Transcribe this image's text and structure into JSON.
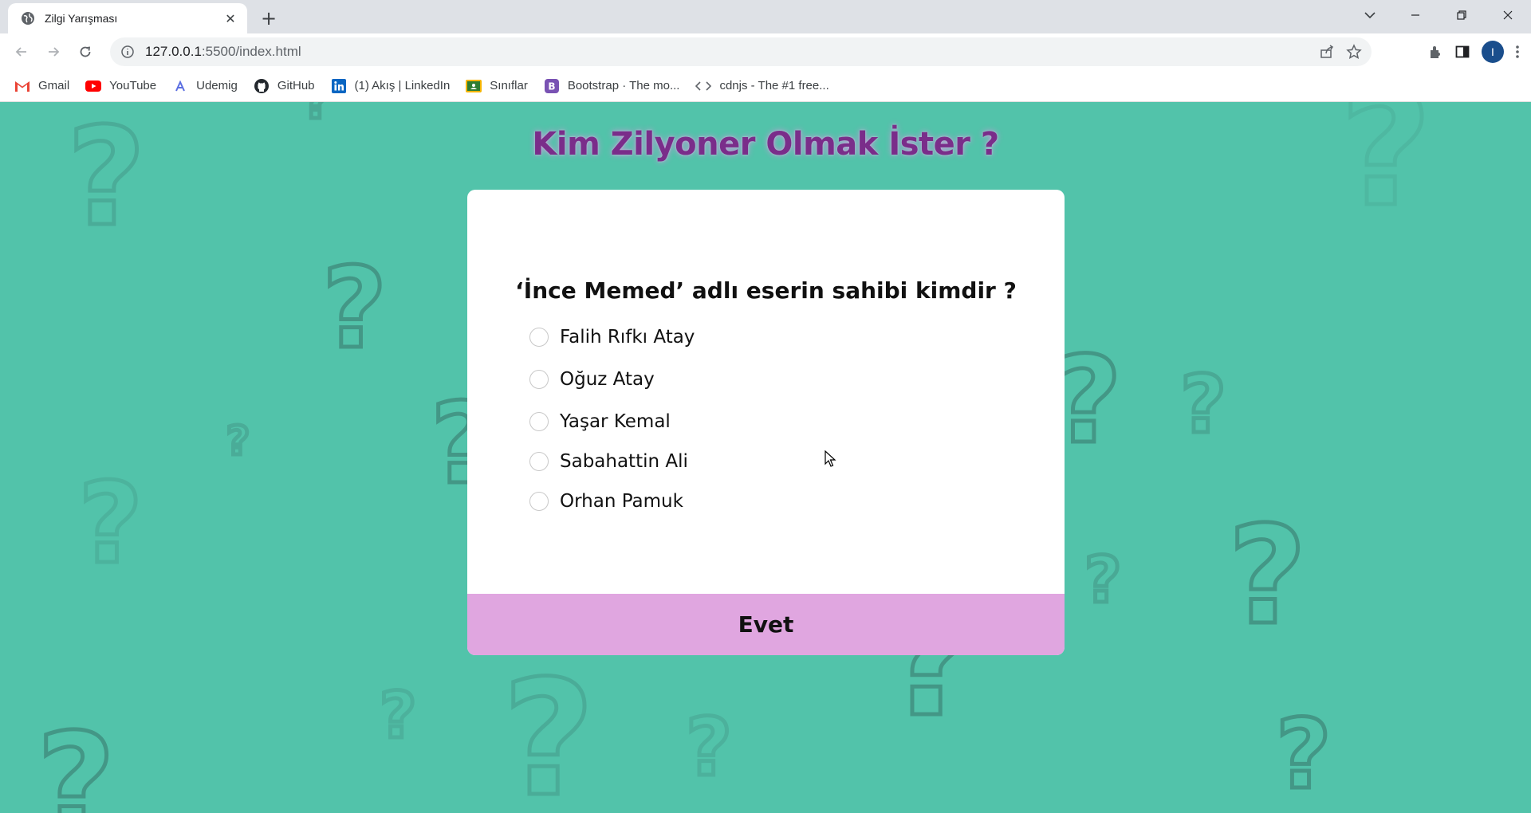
{
  "browser": {
    "tab": {
      "title": "Zilgi Yarışması"
    },
    "new_tab_symbol": "+",
    "close_symbol": "✕",
    "url": {
      "host": "127.0.0.1",
      "rest": ":5500/index.html"
    },
    "avatar_letter": "I",
    "bookmarks": [
      {
        "label": "Gmail",
        "icon": "gmail-icon",
        "color": "#ea4335"
      },
      {
        "label": "YouTube",
        "icon": "youtube-icon",
        "color": "#ff0000"
      },
      {
        "label": "Udemig",
        "icon": "udemig-icon",
        "color": "#5b6ee1"
      },
      {
        "label": "GitHub",
        "icon": "github-icon",
        "color": "#24292e"
      },
      {
        "label": "(1) Akış | LinkedIn",
        "icon": "linkedin-icon",
        "color": "#0a66c2"
      },
      {
        "label": "Sınıflar",
        "icon": "classroom-icon",
        "color": "#f4b400"
      },
      {
        "label": "Bootstrap · The mo...",
        "icon": "bootstrap-icon",
        "color": "#7952b3"
      },
      {
        "label": "cdnjs - The #1 free...",
        "icon": "code-icon",
        "color": "#5f6368"
      }
    ]
  },
  "page": {
    "title": "Kim Zilyoner Olmak İster ?",
    "question": "‘İnce Memed’ adlı eserin sahibi kimdir ?",
    "options": [
      {
        "label": "Falih Rıfkı Atay",
        "checked": false
      },
      {
        "label": "Oğuz Atay",
        "checked": false
      },
      {
        "label": "Yaşar Kemal",
        "checked": false
      },
      {
        "label": "Sabahattin Ali",
        "checked": false
      },
      {
        "label": "Orhan Pamuk",
        "checked": false
      }
    ],
    "submit_label": "Evet",
    "colors": {
      "background": "#52c3aa",
      "title": "#7a2d8a",
      "button": "#e0a6e0"
    }
  }
}
